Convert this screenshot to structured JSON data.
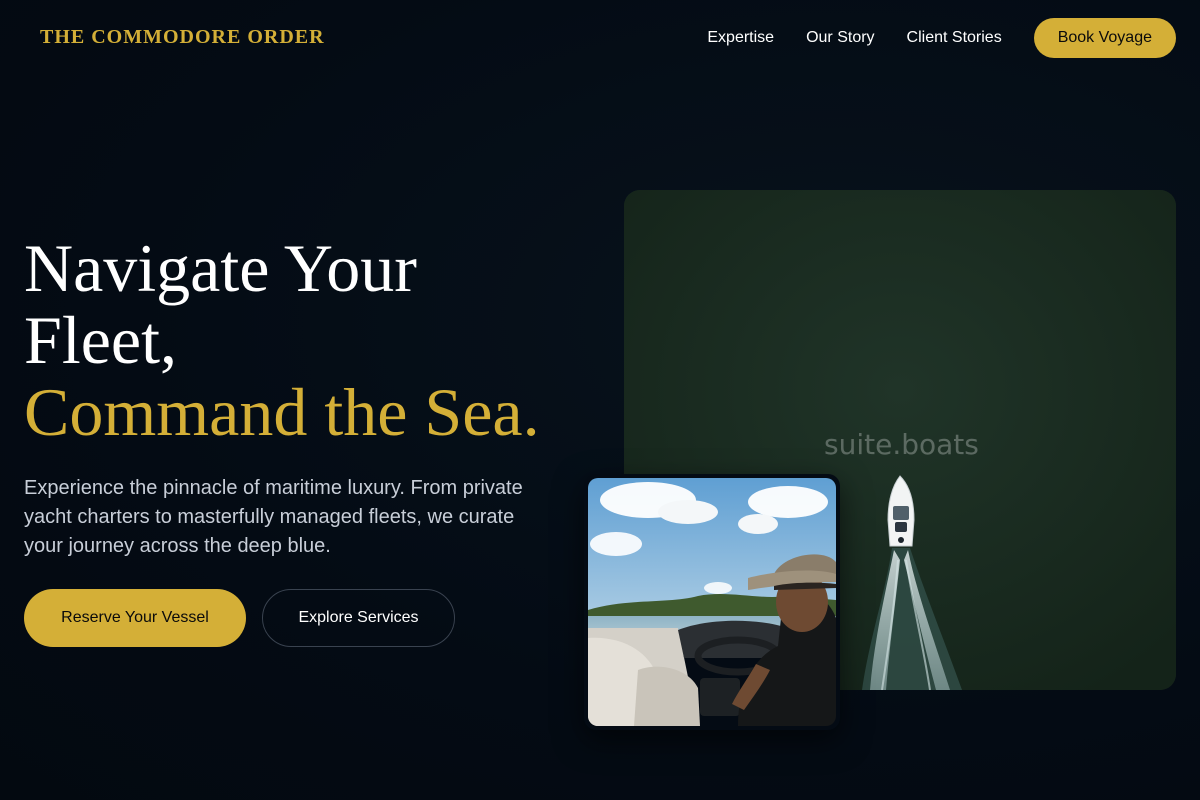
{
  "brand": {
    "name": "THE COMMODORE ORDER",
    "color": "#d4af37"
  },
  "nav": {
    "links": [
      "Expertise",
      "Our Story",
      "Client Stories"
    ],
    "cta_label": "Book Voyage"
  },
  "hero": {
    "title_lines": [
      "Navigate Your",
      "Fleet,"
    ],
    "title_accent": "Command the Sea.",
    "description": "Experience the pinnacle of maritime luxury. From private yacht charters to masterfully managed fleets, we curate your journey across the deep blue.",
    "primary_cta": "Reserve Your Vessel",
    "secondary_cta": "Explore Services"
  },
  "media": {
    "main_image_watermark": "suite.boats",
    "main_image_subject": "aerial view of speedboat wake on dark green water",
    "inset_image_subject": "captain in straw hat at boat helm"
  },
  "colors": {
    "background": "#040b14",
    "accent": "#d4af37",
    "text": "#ffffff",
    "muted_text": "#c8ced8"
  }
}
